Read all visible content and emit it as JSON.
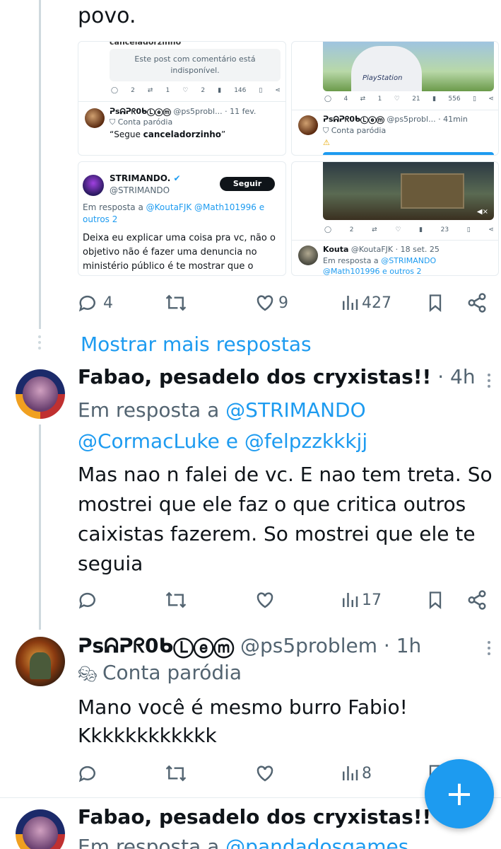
{
  "top_text": "povo.",
  "quote_grid": {
    "card1": {
      "overflow_handle": "canceladorzinho",
      "unavailable_text": "Este post com comentário está indisponível.",
      "stats": {
        "replies": "2",
        "reposts": "1",
        "likes": "2",
        "views": "146"
      },
      "author_name": "ᕈsᕱᕈᖇ0ᑲⓁⓔⓜ",
      "author_handle": "@ps5probl...",
      "date": "· 11 fev.",
      "parody_label": "Conta paródia",
      "body_prefix": "“Segue ",
      "body_bold": "canceladorzinho",
      "body_suffix": "”"
    },
    "card2": {
      "image_caption": "PlayStation",
      "stats": {
        "replies": "4",
        "reposts": "1",
        "likes": "21",
        "views": "556"
      },
      "author_name": "ᕈsᕱᕈᖇ0ᑲⓁⓔⓜ",
      "author_handle": "@ps5probl...",
      "date": "· 41min",
      "parody_label": "Conta paródia",
      "warning": "⚠"
    },
    "card3": {
      "author_name": "STRIMANDO.",
      "author_handle": "@STRIMANDO",
      "follow_label": "Seguir",
      "reply_to_prefix": "Em resposta a ",
      "reply_to_links": "@KoutaFJK @Math101996 e outros 2",
      "body": "Deixa eu explicar uma coisa pra vc, não o objetivo não é fazer uma denuncia no ministério público é te mostrar que o"
    },
    "card4": {
      "stats": {
        "replies": "2",
        "views": "23"
      },
      "author_name": "Kouta",
      "author_handle": "@KoutaFJK",
      "date": "· 18 set. 25",
      "reply_to_prefix": "Em resposta a ",
      "reply_to_links": "@STRIMANDO @Math101996 e outros 2"
    }
  },
  "post0_actions": {
    "replies": "4",
    "likes": "9",
    "views": "427"
  },
  "show_more": "Mostrar mais respostas",
  "post1": {
    "name": "Fabao, pesadelo dos cryxistas!!",
    "time": "· 4h",
    "reply_prefix": "Em resposta a ",
    "reply_line1_link": "@STRIMANDO",
    "reply_line2_link_a": "@CormacLuke",
    "reply_line2_sep": " e ",
    "reply_line2_link_b": "@felpzzkkkjj",
    "body": "Mas nao n falei de vc. E nao tem treta. So mostrei que ele faz o que critica outros caixistas fazerem. So mostrei que ele te seguia",
    "views": "17"
  },
  "post2": {
    "name": "ᕈsᕱᕈᖇ0ᑲⓁⓔⓜ",
    "handle": "@ps5problem",
    "time": "· 1h",
    "parody_label": "Conta paródia",
    "body": "Mano você é mesmo burro Fabio! Kkkkkkkkkkkk",
    "views": "8"
  },
  "post3": {
    "name": "Fabao, pesadelo dos cryxistas!!",
    "reply_prefix": "Em resposta a ",
    "reply_link": "@pandadosgames"
  },
  "fab": {
    "label": "+"
  },
  "colors": {
    "accent": "#1d9bf0",
    "text": "#0f1419",
    "muted": "#536471",
    "line": "#cfd9de"
  }
}
